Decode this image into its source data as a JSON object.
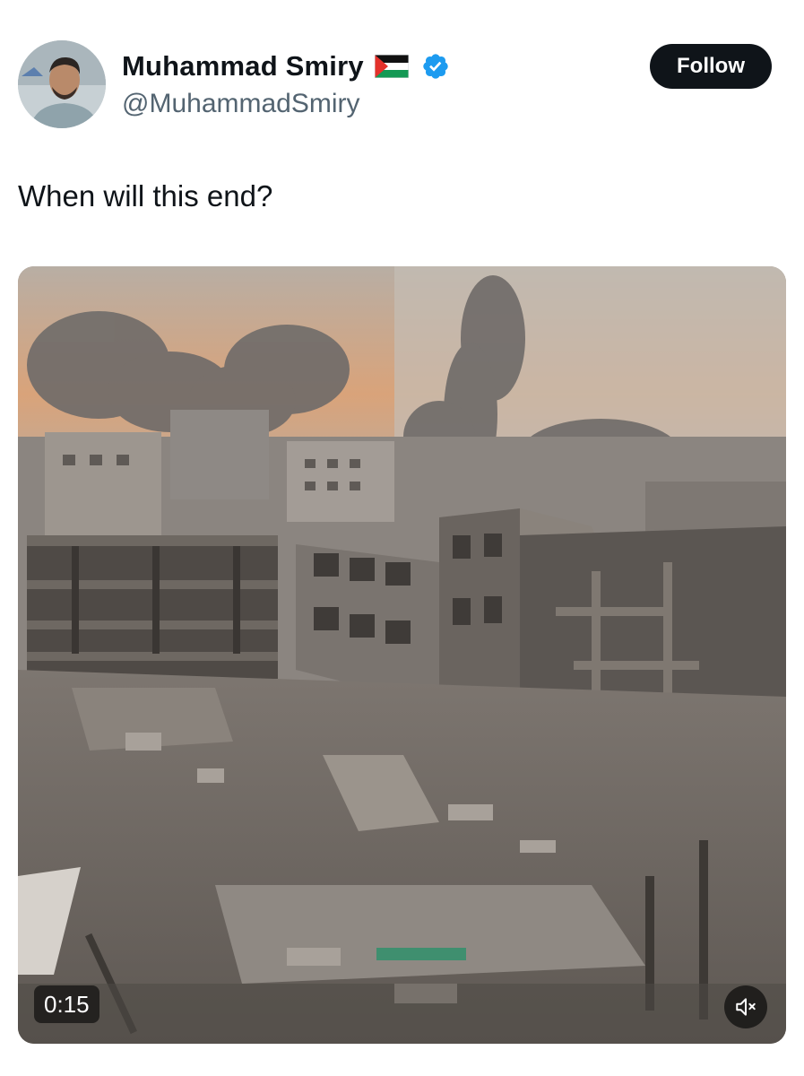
{
  "user": {
    "display_name": "Muhammad Smiry",
    "handle": "@MuhammadSmiry",
    "flag_icon": "palestine-flag-icon",
    "verified_icon": "verified-badge-icon",
    "verified_color": "#1d9bf0"
  },
  "follow_button": {
    "label": "Follow"
  },
  "tweet": {
    "text": "When will this end?"
  },
  "video": {
    "duration": "0:15",
    "mute_icon": "speaker-muted-icon"
  }
}
